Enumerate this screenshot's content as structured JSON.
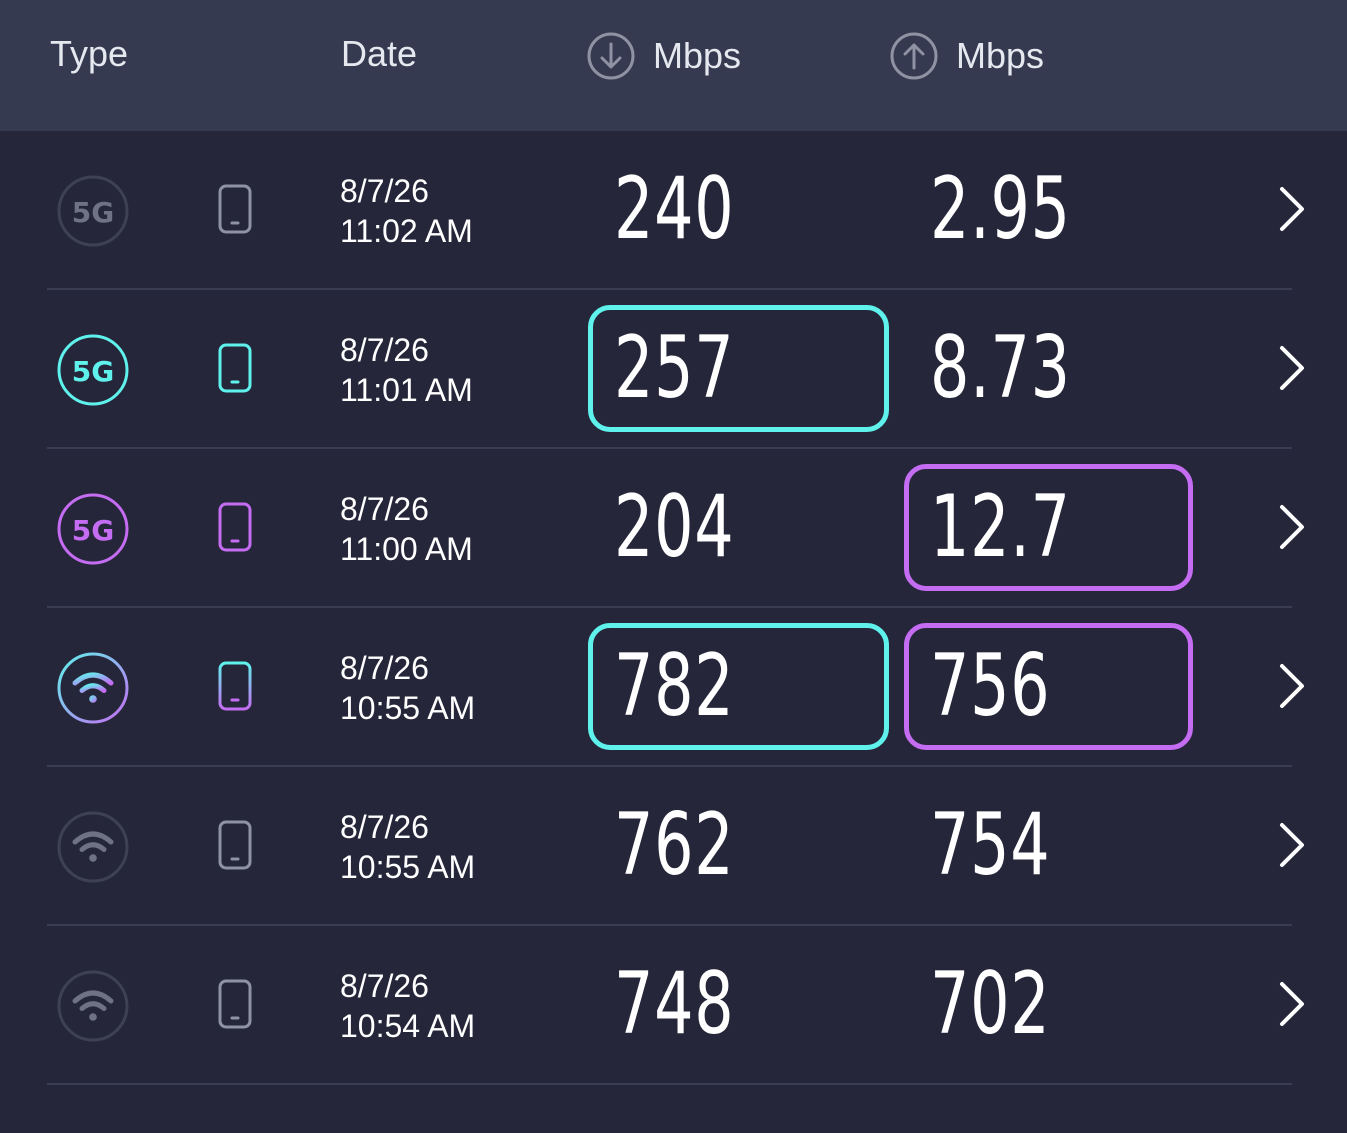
{
  "header": {
    "type_label": "Type",
    "date_label": "Date",
    "download_label": "Mbps",
    "upload_label": "Mbps",
    "download_icon": "arrow-down-circle-icon",
    "upload_icon": "arrow-up-circle-icon"
  },
  "colors": {
    "background": "#26263a",
    "header_bg": "#353a50",
    "divider": "#3a3d52",
    "muted_icon": "#6f7283",
    "cyan_accent": "#5ff2ec",
    "purple_accent": "#c46cf2",
    "text": "#ffffff"
  },
  "results": [
    {
      "connection": "5G",
      "connection_icon": "5g-icon",
      "icon_style": "muted",
      "device_icon": "phone-icon",
      "date": "8/7/26",
      "time": "11:02 AM",
      "download": "240",
      "upload": "2.95",
      "download_highlight": false,
      "upload_highlight": false
    },
    {
      "connection": "5G",
      "connection_icon": "5g-icon",
      "icon_style": "cyan",
      "device_icon": "phone-icon",
      "date": "8/7/26",
      "time": "11:01 AM",
      "download": "257",
      "upload": "8.73",
      "download_highlight": true,
      "upload_highlight": false
    },
    {
      "connection": "5G",
      "connection_icon": "5g-icon",
      "icon_style": "purple",
      "device_icon": "phone-icon",
      "date": "8/7/26",
      "time": "11:00 AM",
      "download": "204",
      "upload": "12.7",
      "download_highlight": false,
      "upload_highlight": true
    },
    {
      "connection": "wifi",
      "connection_icon": "wifi-icon",
      "icon_style": "gradient",
      "device_icon": "phone-icon",
      "date": "8/7/26",
      "time": "10:55 AM",
      "download": "782",
      "upload": "756",
      "download_highlight": true,
      "upload_highlight": true
    },
    {
      "connection": "wifi",
      "connection_icon": "wifi-icon",
      "icon_style": "muted",
      "device_icon": "phone-icon",
      "date": "8/7/26",
      "time": "10:55 AM",
      "download": "762",
      "upload": "754",
      "download_highlight": false,
      "upload_highlight": false
    },
    {
      "connection": "wifi",
      "connection_icon": "wifi-icon",
      "icon_style": "muted",
      "device_icon": "phone-icon",
      "date": "8/7/26",
      "time": "10:54 AM",
      "download": "748",
      "upload": "702",
      "download_highlight": false,
      "upload_highlight": false
    }
  ]
}
